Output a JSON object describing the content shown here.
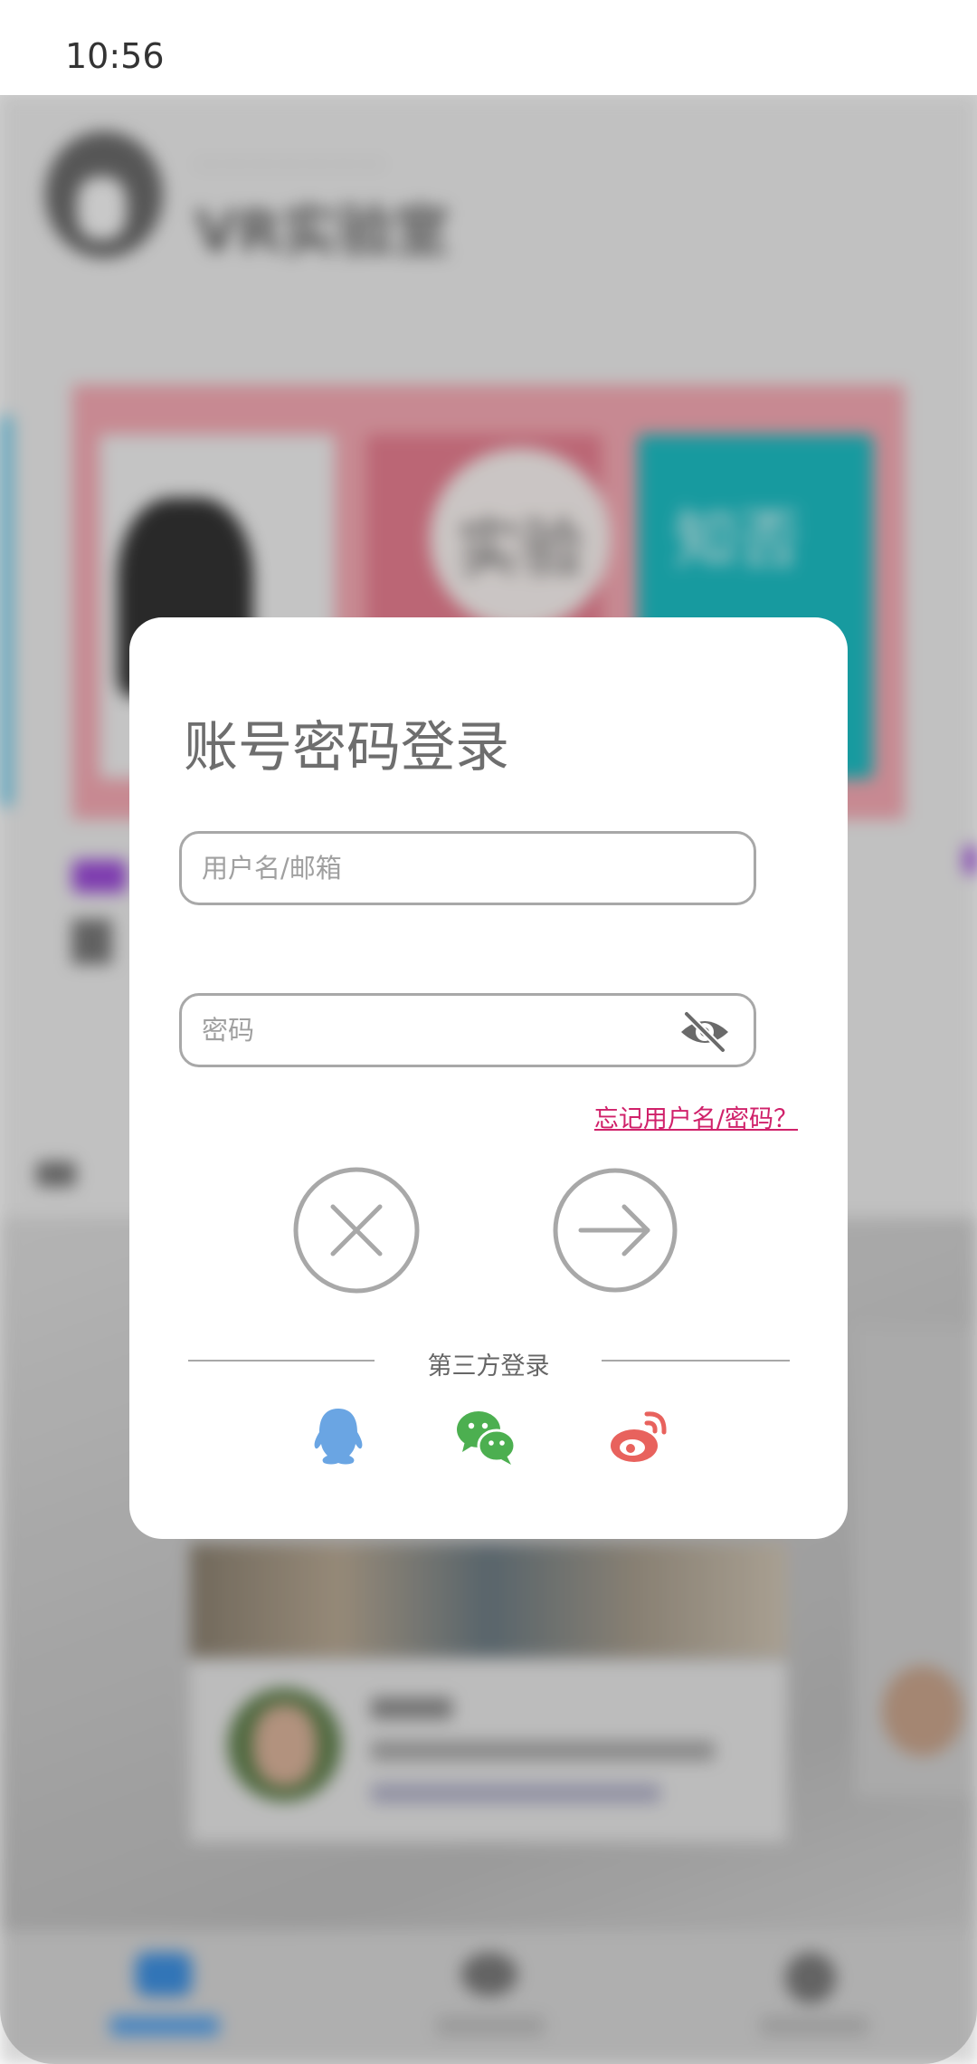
{
  "status_bar": {
    "time": "10:56"
  },
  "background": {
    "app_title": "VR实验室",
    "banner_texts": [
      "实验",
      "知否"
    ]
  },
  "dialog": {
    "title": "账号密码登录",
    "username_placeholder": "用户名/邮箱",
    "password_placeholder": "密码",
    "forgot_link": "忘记用户名/密码？",
    "third_party_label": "第三方登录",
    "buttons": {
      "cancel_icon": "close-icon",
      "submit_icon": "arrow-right-icon"
    },
    "social_logins": [
      {
        "name": "qq-icon",
        "color": "#6aa5e3"
      },
      {
        "name": "wechat-icon",
        "color": "#4caf50"
      },
      {
        "name": "weibo-icon",
        "color": "#e8625d"
      }
    ]
  },
  "colors": {
    "link": "#d0216a",
    "border": "#a8a8a8",
    "title": "#6e6e6e"
  }
}
